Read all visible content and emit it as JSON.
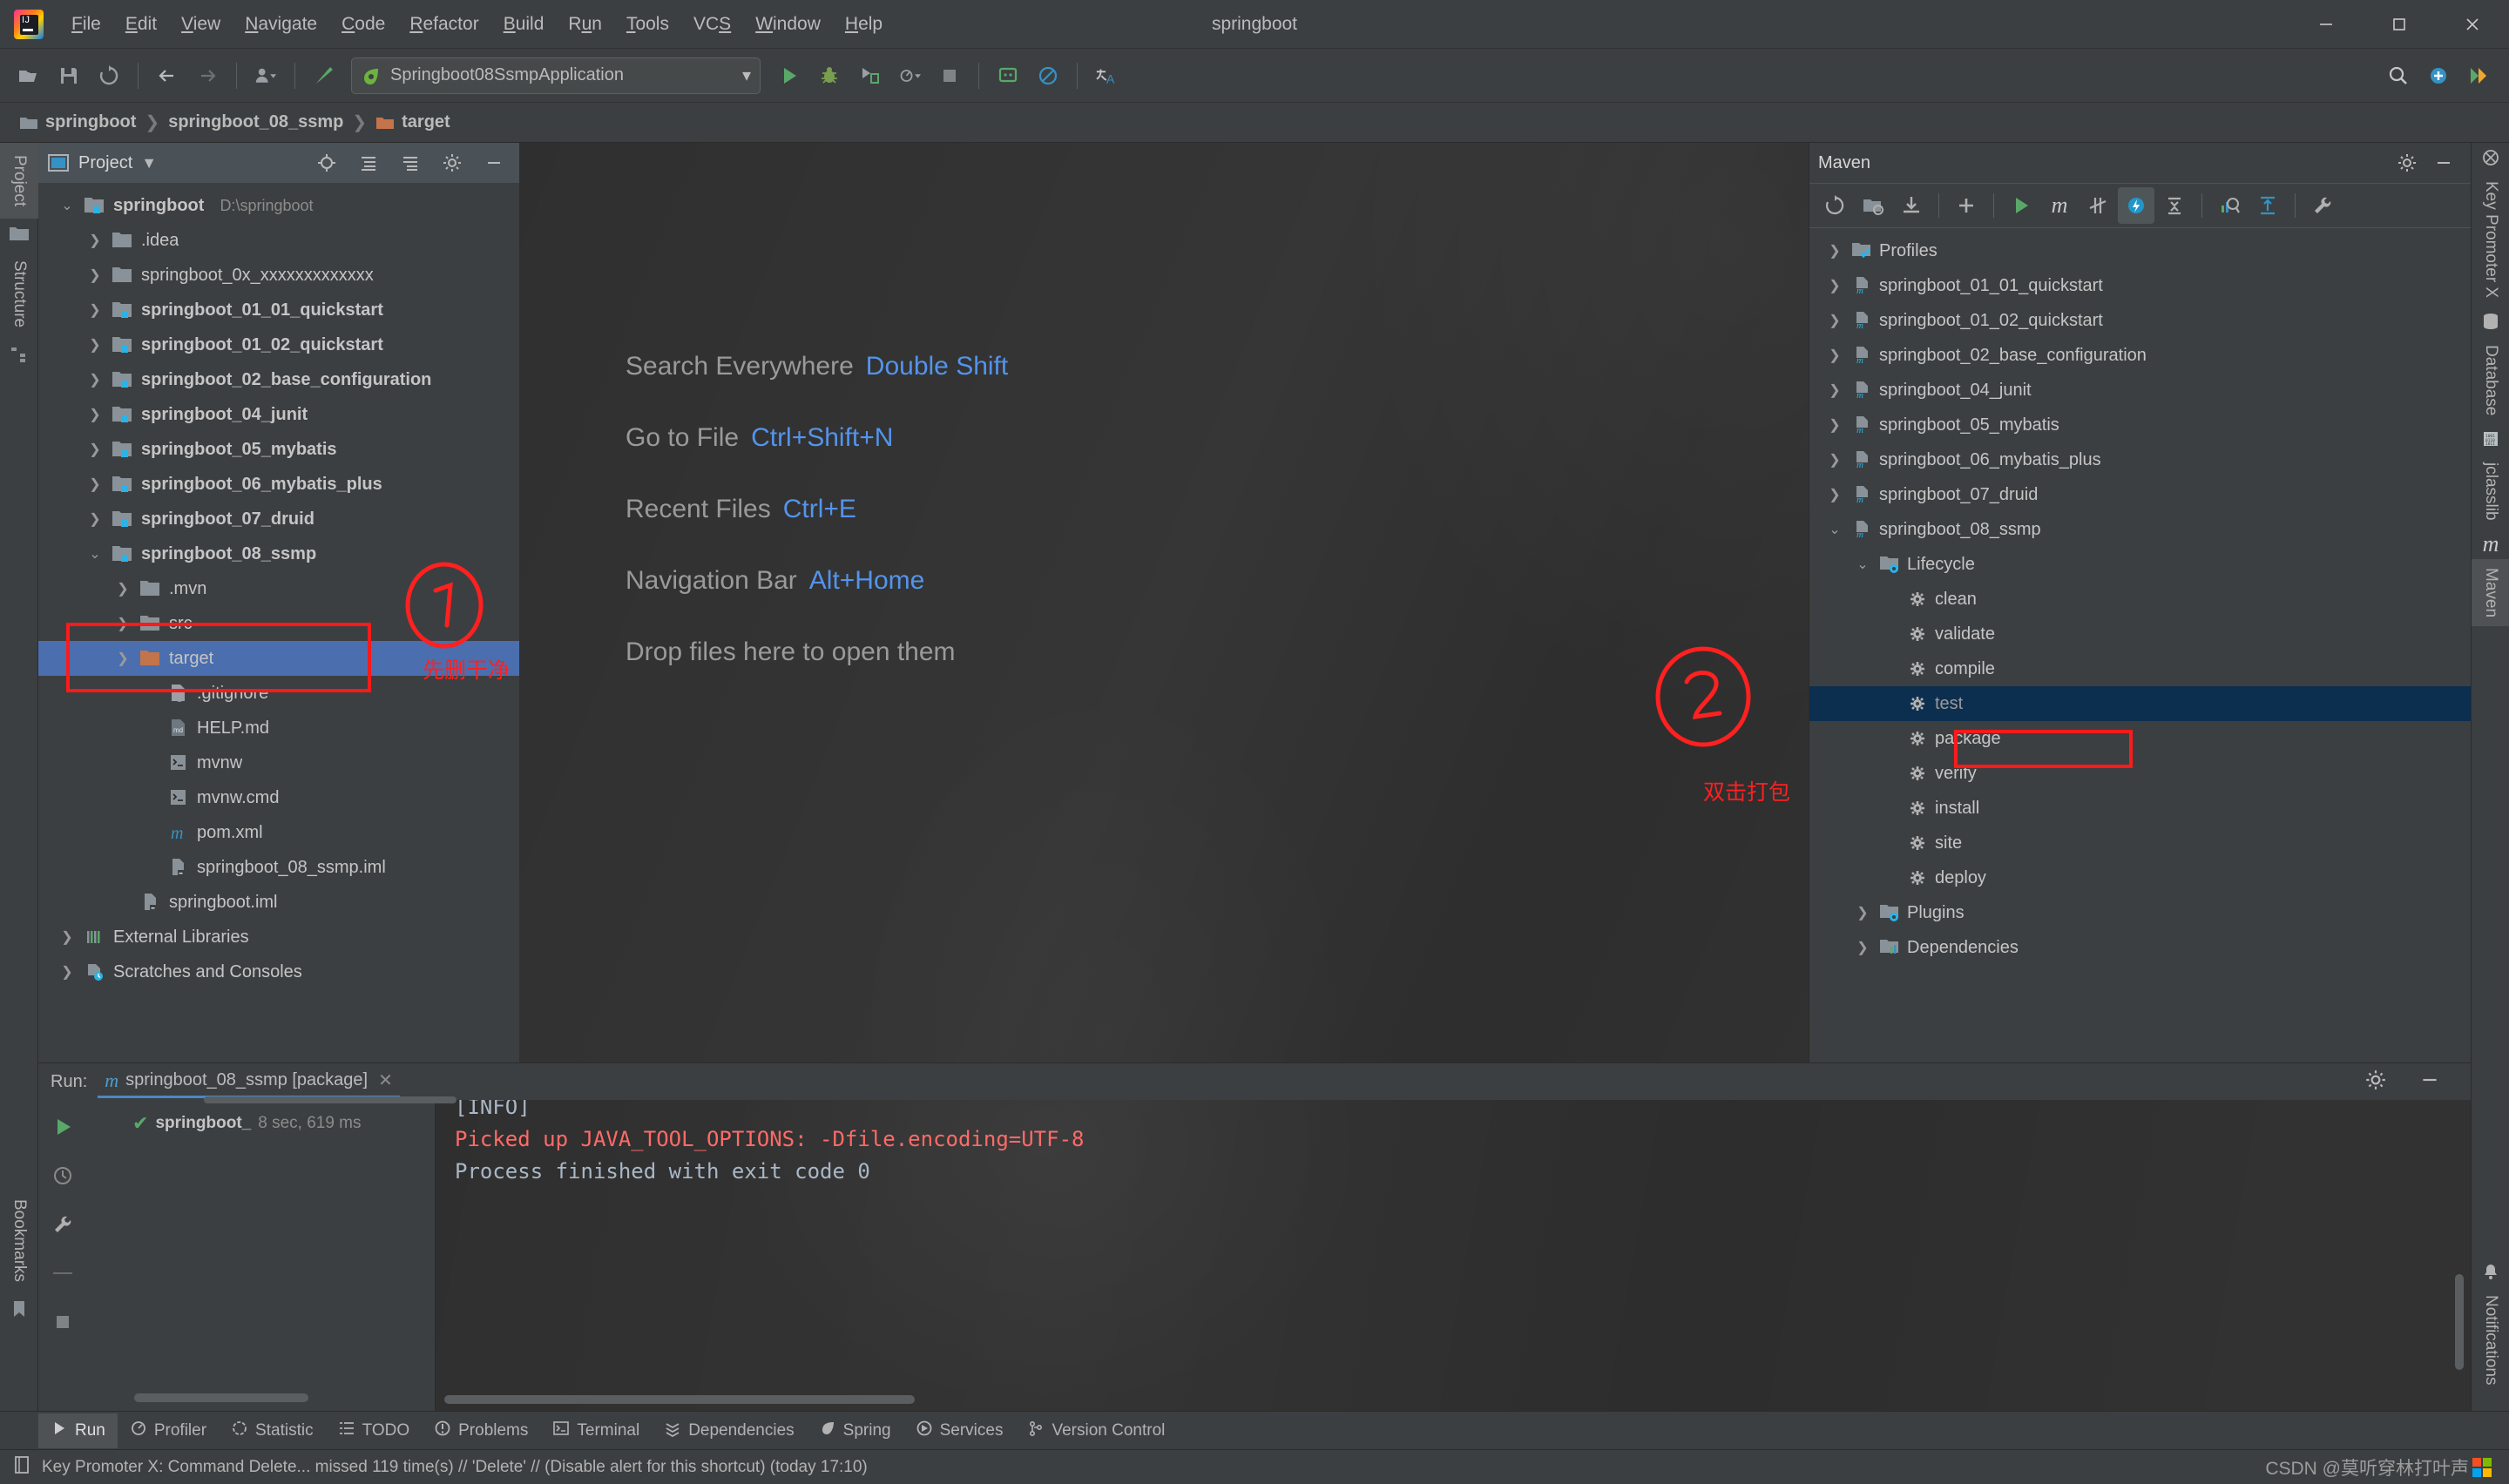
{
  "window": {
    "title": "springboot"
  },
  "menubar": {
    "items": [
      {
        "label": "File",
        "mn": "F"
      },
      {
        "label": "Edit",
        "mn": "E"
      },
      {
        "label": "View",
        "mn": "V"
      },
      {
        "label": "Navigate",
        "mn": "N"
      },
      {
        "label": "Code",
        "mn": "C"
      },
      {
        "label": "Refactor",
        "mn": "R"
      },
      {
        "label": "Build",
        "mn": "B"
      },
      {
        "label": "Run",
        "mn": "u"
      },
      {
        "label": "Tools",
        "mn": "T"
      },
      {
        "label": "VCS",
        "mn": "S"
      },
      {
        "label": "Window",
        "mn": "W"
      },
      {
        "label": "Help",
        "mn": "H"
      }
    ]
  },
  "window_controls": {
    "minimize": "minimize-icon",
    "maximize": "maximize-icon",
    "close": "close-icon"
  },
  "toolbar": {
    "buttons": [
      {
        "name": "open-project-icon",
        "title": "Open"
      },
      {
        "name": "save-all-icon",
        "title": "Save All"
      },
      {
        "name": "sync-icon",
        "title": "Synchronize"
      },
      {
        "name": "back-arrow-icon",
        "title": "Back"
      },
      {
        "name": "forward-arrow-icon",
        "title": "Forward"
      },
      {
        "name": "user-icon",
        "title": "Collaborate"
      },
      {
        "name": "build-hammer-icon",
        "title": "Build Project"
      }
    ],
    "run_config": "Springboot08SsmpApplication",
    "run_icon": "run-icon",
    "debug_icon": "debug-icon",
    "run-with-coverage_icon": "coverage-icon",
    "profile_icon": "profile-icon",
    "stop_icon": "stop-icon",
    "updates_icon": "updates-icon",
    "no_inspections_icon": "no-inspections-icon",
    "translate_icon": "translate-icon",
    "search_icon": "search-icon",
    "notification_icon": "notifications-icon",
    "feedback_icon": "feedback-icon"
  },
  "breadcrumb": {
    "items": [
      "springboot",
      "springboot_08_ssmp",
      "target"
    ]
  },
  "left_stripe": {
    "items": [
      {
        "label": "Project",
        "active": true
      },
      {
        "label": "Structure",
        "active": false
      }
    ],
    "bookmarks_label": "Bookmarks"
  },
  "right_stripe": {
    "items": [
      {
        "label": "Key Promoter X"
      },
      {
        "label": "Database"
      },
      {
        "label": "jclasslib"
      },
      {
        "label": "Maven",
        "active": true
      },
      {
        "label": "Notifications"
      }
    ]
  },
  "project_panel": {
    "title": "Project",
    "header_buttons": [
      "locate-icon",
      "collapse-all-icon",
      "expand-all-icon",
      "settings-gear-icon",
      "hide-icon"
    ],
    "tree": [
      {
        "label": "springboot",
        "sub": "D:\\springboot",
        "depth": 0,
        "arrow": "down",
        "icon": "module-folder",
        "bold": true
      },
      {
        "label": ".idea",
        "sub": "",
        "depth": 1,
        "arrow": "right",
        "icon": "folder",
        "bold": false
      },
      {
        "label": "springboot_0x_xxxxxxxxxxxxx",
        "sub": "",
        "depth": 1,
        "arrow": "right",
        "icon": "folder",
        "bold": false
      },
      {
        "label": "springboot_01_01_quickstart",
        "sub": "",
        "depth": 1,
        "arrow": "right",
        "icon": "module-folder",
        "bold": true
      },
      {
        "label": "springboot_01_02_quickstart",
        "sub": "",
        "depth": 1,
        "arrow": "right",
        "icon": "module-folder",
        "bold": true
      },
      {
        "label": "springboot_02_base_configuration",
        "sub": "",
        "depth": 1,
        "arrow": "right",
        "icon": "module-folder",
        "bold": true
      },
      {
        "label": "springboot_04_junit",
        "sub": "",
        "depth": 1,
        "arrow": "right",
        "icon": "module-folder",
        "bold": true
      },
      {
        "label": "springboot_05_mybatis",
        "sub": "",
        "depth": 1,
        "arrow": "right",
        "icon": "module-folder",
        "bold": true
      },
      {
        "label": "springboot_06_mybatis_plus",
        "sub": "",
        "depth": 1,
        "arrow": "right",
        "icon": "module-folder",
        "bold": true
      },
      {
        "label": "springboot_07_druid",
        "sub": "",
        "depth": 1,
        "arrow": "right",
        "icon": "module-folder",
        "bold": true
      },
      {
        "label": "springboot_08_ssmp",
        "sub": "",
        "depth": 1,
        "arrow": "down",
        "icon": "module-folder",
        "bold": true
      },
      {
        "label": ".mvn",
        "sub": "",
        "depth": 2,
        "arrow": "right",
        "icon": "folder",
        "bold": false
      },
      {
        "label": "src",
        "sub": "",
        "depth": 2,
        "arrow": "right",
        "icon": "folder",
        "bold": false
      },
      {
        "label": "target",
        "sub": "",
        "depth": 2,
        "arrow": "right",
        "icon": "folder-orange",
        "bold": false,
        "selected": true
      },
      {
        "label": ".gitignore",
        "sub": "",
        "depth": 3,
        "arrow": "none",
        "icon": "git-file",
        "bold": false
      },
      {
        "label": "HELP.md",
        "sub": "",
        "depth": 3,
        "arrow": "none",
        "icon": "md-file",
        "bold": false
      },
      {
        "label": "mvnw",
        "sub": "",
        "depth": 3,
        "arrow": "none",
        "icon": "script-file",
        "bold": false
      },
      {
        "label": "mvnw.cmd",
        "sub": "",
        "depth": 3,
        "arrow": "none",
        "icon": "cmd-file",
        "bold": false
      },
      {
        "label": "pom.xml",
        "sub": "",
        "depth": 3,
        "arrow": "none",
        "icon": "maven-file",
        "bold": false
      },
      {
        "label": "springboot_08_ssmp.iml",
        "sub": "",
        "depth": 3,
        "arrow": "none",
        "icon": "iml-file",
        "bold": false
      },
      {
        "label": "springboot.iml",
        "sub": "",
        "depth": 2,
        "arrow": "none",
        "icon": "iml-file",
        "bold": false
      },
      {
        "label": "External Libraries",
        "sub": "",
        "depth": 0,
        "arrow": "right",
        "icon": "libraries",
        "bold": false
      },
      {
        "label": "Scratches and Consoles",
        "sub": "",
        "depth": 0,
        "arrow": "right",
        "icon": "scratches",
        "bold": false
      }
    ]
  },
  "editor": {
    "tips": [
      {
        "label": "Search Everywhere",
        "key": "Double Shift"
      },
      {
        "label": "Go to File",
        "key": "Ctrl+Shift+N"
      },
      {
        "label": "Recent Files",
        "key": "Ctrl+E"
      },
      {
        "label": "Navigation Bar",
        "key": "Alt+Home"
      },
      {
        "label": "Drop files here to open them",
        "key": ""
      }
    ]
  },
  "maven_panel": {
    "title": "Maven",
    "header_buttons": [
      "settings-gear-icon",
      "hide-icon"
    ],
    "toolbar_buttons": [
      {
        "name": "reload-all-icon"
      },
      {
        "name": "add-maven-project-icon"
      },
      {
        "name": "download-sources-icon"
      },
      {
        "name": "add-icon"
      },
      {
        "name": "run-maven-build-icon"
      },
      {
        "name": "execute-maven-goal-icon"
      },
      {
        "name": "toggle-skip-tests-icon"
      },
      {
        "name": "toggle-offline-mode-icon",
        "on": true
      },
      {
        "name": "collapse-all-icon"
      },
      {
        "name": "show-dependencies-icon"
      },
      {
        "name": "expand-all-icon"
      },
      {
        "name": "maven-settings-icon"
      }
    ],
    "tree": [
      {
        "label": "Profiles",
        "depth": 0,
        "arrow": "right",
        "icon": "profiles"
      },
      {
        "label": "springboot_01_01_quickstart",
        "depth": 0,
        "arrow": "right",
        "icon": "maven-module"
      },
      {
        "label": "springboot_01_02_quickstart",
        "depth": 0,
        "arrow": "right",
        "icon": "maven-module"
      },
      {
        "label": "springboot_02_base_configuration",
        "depth": 0,
        "arrow": "right",
        "icon": "maven-module"
      },
      {
        "label": "springboot_04_junit",
        "depth": 0,
        "arrow": "right",
        "icon": "maven-module"
      },
      {
        "label": "springboot_05_mybatis",
        "depth": 0,
        "arrow": "right",
        "icon": "maven-module"
      },
      {
        "label": "springboot_06_mybatis_plus",
        "depth": 0,
        "arrow": "right",
        "icon": "maven-module"
      },
      {
        "label": "springboot_07_druid",
        "depth": 0,
        "arrow": "right",
        "icon": "maven-module"
      },
      {
        "label": "springboot_08_ssmp",
        "depth": 0,
        "arrow": "down",
        "icon": "maven-module"
      },
      {
        "label": "Lifecycle",
        "depth": 1,
        "arrow": "down",
        "icon": "lifecycle"
      },
      {
        "label": "clean",
        "depth": 2,
        "arrow": "none",
        "icon": "goal"
      },
      {
        "label": "validate",
        "depth": 2,
        "arrow": "none",
        "icon": "goal"
      },
      {
        "label": "compile",
        "depth": 2,
        "arrow": "none",
        "icon": "goal"
      },
      {
        "label": "test",
        "depth": 2,
        "arrow": "none",
        "icon": "goal",
        "selected": true
      },
      {
        "label": "package",
        "depth": 2,
        "arrow": "none",
        "icon": "goal",
        "boxed": true
      },
      {
        "label": "verify",
        "depth": 2,
        "arrow": "none",
        "icon": "goal"
      },
      {
        "label": "install",
        "depth": 2,
        "arrow": "none",
        "icon": "goal"
      },
      {
        "label": "site",
        "depth": 2,
        "arrow": "none",
        "icon": "goal"
      },
      {
        "label": "deploy",
        "depth": 2,
        "arrow": "none",
        "icon": "goal"
      },
      {
        "label": "Plugins",
        "depth": 1,
        "arrow": "right",
        "icon": "lifecycle"
      },
      {
        "label": "Dependencies",
        "depth": 1,
        "arrow": "right",
        "icon": "dependencies"
      }
    ]
  },
  "run_panel": {
    "label": "Run:",
    "tab_title": "springboot_08_ssmp [package]",
    "tab_close": "close-icon",
    "gutter_buttons": [
      "rerun-icon",
      "toggle-tests-icon",
      "settings-wrench-icon",
      "separator",
      "stop-icon"
    ],
    "header_buttons": [
      "settings-gear-icon",
      "hide-icon"
    ],
    "tree_row": {
      "status": "passed",
      "name": "springboot_",
      "duration": "8 sec, 619 ms"
    },
    "console": [
      "[INFO]",
      "",
      "Picked up JAVA_TOOL_OPTIONS: -Dfile.encoding=UTF-8",
      "",
      "",
      "Process finished with exit code 0"
    ],
    "console_colors": {
      "error": "#ff6b68",
      "normal": "#a9b7c6"
    }
  },
  "bottom_bar": {
    "items": [
      {
        "label": "Run",
        "icon": "run-icon",
        "active": true
      },
      {
        "label": "Profiler",
        "icon": "profiler-icon",
        "active": false
      },
      {
        "label": "Statistic",
        "icon": "statistic-icon",
        "active": false
      },
      {
        "label": "TODO",
        "icon": "todo-icon",
        "active": false
      },
      {
        "label": "Problems",
        "icon": "problems-icon",
        "active": false
      },
      {
        "label": "Terminal",
        "icon": "terminal-icon",
        "active": false
      },
      {
        "label": "Dependencies",
        "icon": "dependencies-icon",
        "active": false
      },
      {
        "label": "Spring",
        "icon": "spring-icon",
        "active": false
      },
      {
        "label": "Services",
        "icon": "services-icon",
        "active": false
      },
      {
        "label": "Version Control",
        "icon": "version-control-icon",
        "active": false
      }
    ]
  },
  "status_bar": {
    "icon": "event-log-icon",
    "message": "Key Promoter X: Command Delete... missed 119 time(s) // 'Delete' // (Disable alert for this shortcut) (today 17:10)"
  },
  "watermark": {
    "text": "CSDN @莫听穿林打叶声"
  },
  "annotations": {
    "marker_one": "①",
    "marker_two": "②",
    "note_one": "先删干净",
    "note_two": "双击打包",
    "color": "#ff2020"
  }
}
